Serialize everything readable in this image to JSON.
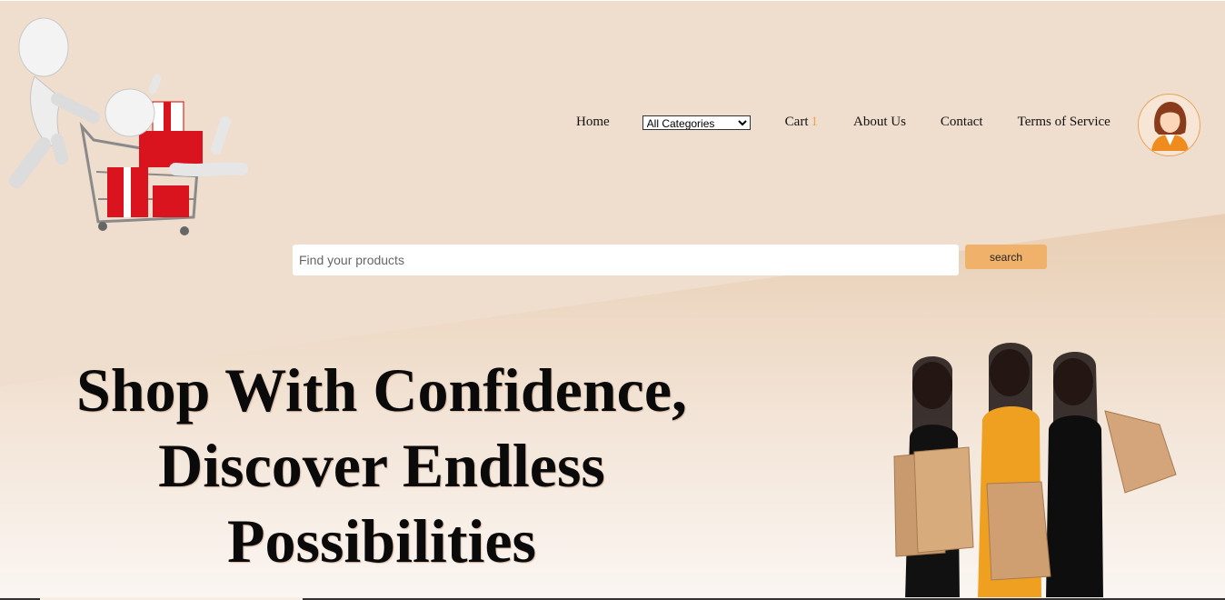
{
  "colors": {
    "background": "#efdecd",
    "accent": "#f0b26b",
    "cart_count": "#e8a25a"
  },
  "header": {
    "logo_icon": "shopping-cart-with-gifts-icon",
    "nav": {
      "home": "Home",
      "categories": {
        "selected": "All Categories",
        "options": [
          "All Categories"
        ]
      },
      "cart_label": "Cart",
      "cart_count": "1",
      "about": "About Us",
      "contact": "Contact",
      "terms": "Terms of Service"
    },
    "avatar_icon": "user-avatar-icon"
  },
  "search": {
    "placeholder": "Find your products",
    "value": "",
    "button_label": "search"
  },
  "hero": {
    "title_line1": "Shop With Confidence,",
    "title_line2": "Discover Endless",
    "title_line3": "Possibilities",
    "image_icon": "shoppers-with-bags-illustration"
  }
}
